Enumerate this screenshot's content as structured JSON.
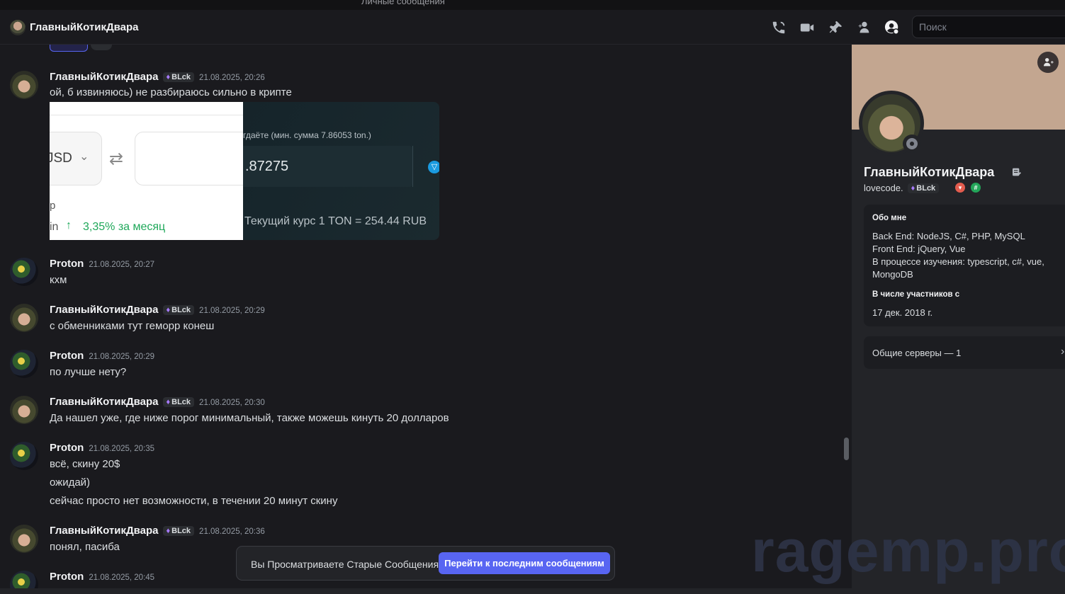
{
  "window": {
    "title": "Личные сообщения"
  },
  "header": {
    "channel_name": "ГлавныйКотикДвара",
    "search_placeholder": "Поиск",
    "icons": [
      "phone-call-icon",
      "video-call-icon",
      "pin-icon",
      "add-friends-icon",
      "user-profile-icon"
    ]
  },
  "messages": [
    {
      "author": "ГлавныйКотикДвара",
      "tag": "BLck",
      "time": "21.08.2025, 20:26",
      "lines": [
        "ой, б извиняюсь) не разбираюсь сильно в крипте"
      ]
    },
    {
      "author": "Proton",
      "tag": "",
      "time": "21.08.2025, 20:27",
      "lines": [
        "кхм"
      ]
    },
    {
      "author": "ГлавныйКотикДвара",
      "tag": "BLck",
      "time": "21.08.2025, 20:29",
      "lines": [
        "с обменниками тут геморр конеш"
      ]
    },
    {
      "author": "Proton",
      "tag": "",
      "time": "21.08.2025, 20:29",
      "lines": [
        "по лучше нету?"
      ]
    },
    {
      "author": "ГлавныйКотикДвара",
      "tag": "BLck",
      "time": "21.08.2025, 20:30",
      "lines": [
        "Да нашел уже, где ниже порог минимальный, также можешь кинуть 20 долларов"
      ]
    },
    {
      "author": "Proton",
      "tag": "",
      "time": "21.08.2025, 20:35",
      "lines": [
        "всё, скину 20$",
        "ожидай)",
        "сейчас просто нет возможности, в течении 20 минут скину"
      ]
    },
    {
      "author": "ГлавныйКотикДвара",
      "tag": "BLck",
      "time": "21.08.2025, 20:36",
      "lines": [
        "понял, пасиба"
      ]
    },
    {
      "author": "Proton",
      "tag": "",
      "time": "21.08.2025, 20:45",
      "lines": []
    }
  ],
  "attachment_dark": {
    "label": "гдаёте (мин. сумма 7.86053 ton.)",
    "value": ".87275",
    "rate": "Текущий курс   1 TON = 254.44 RUB"
  },
  "attachment_white": {
    "currency": "JSD",
    "p": "p",
    "in": "in",
    "change": "3,35%  за месяц"
  },
  "banner": {
    "text": "Вы Просматриваете Старые Сообщения",
    "button": "Перейти к последним сообщениям"
  },
  "profile": {
    "name": "ГлавныйКотикДвара",
    "username": "lovecode.",
    "tag": "BLck",
    "about_title": "Обо мне",
    "about_lines": [
      "Back End: NodeJS, C#, PHP, MySQL",
      "Front End: jQuery, Vue",
      "В процессе изучения: typescript, c#, vue,",
      "MongoDB"
    ],
    "member_since_title": "В числе участников с",
    "member_since": "17 дек. 2018 г.",
    "mutual_servers": "Общие серверы — 1"
  },
  "watermark": "ragemp.pro",
  "colors": {
    "accent": "#5865f2",
    "bg": "#1a1a1e",
    "panel": "#232428"
  }
}
